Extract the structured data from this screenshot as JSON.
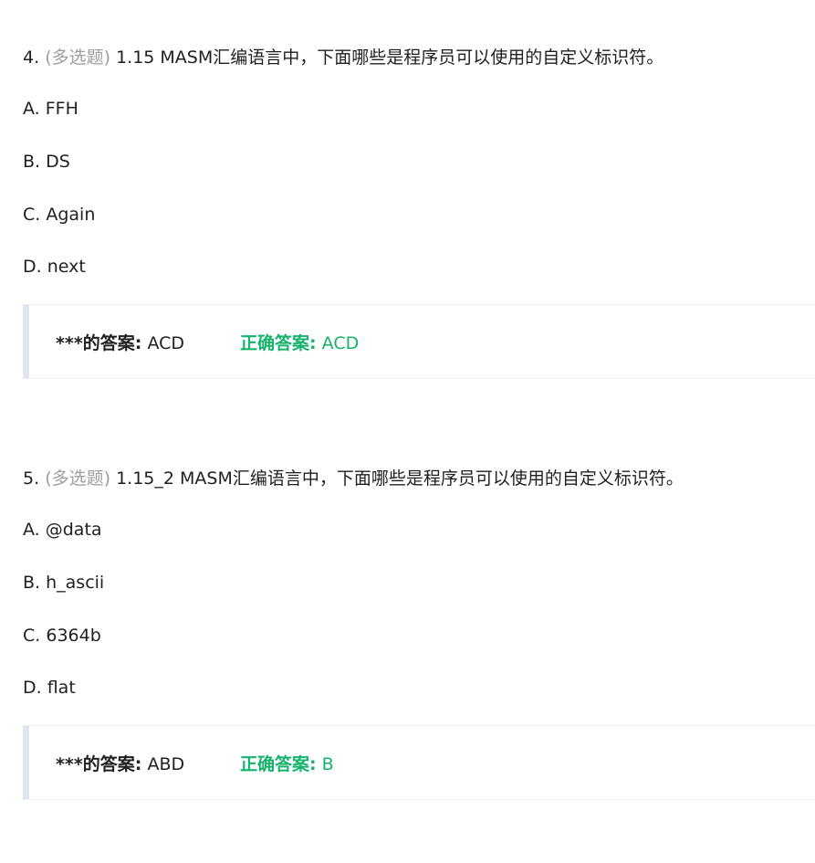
{
  "questions": [
    {
      "number": "4.",
      "type": "(多选题)",
      "text": "1.15 MASM汇编语言中，下面哪些是程序员可以使用的自定义标识符。",
      "options": [
        {
          "letter": "A.",
          "text": "FFH"
        },
        {
          "letter": "B.",
          "text": "DS"
        },
        {
          "letter": "C.",
          "text": "Again"
        },
        {
          "letter": "D.",
          "text": "next"
        }
      ],
      "my_answer_label": "***的答案:",
      "my_answer": "ACD",
      "correct_answer_label": "正确答案:",
      "correct_answer": "ACD"
    },
    {
      "number": "5.",
      "type": "(多选题)",
      "text": "1.15_2 MASM汇编语言中，下面哪些是程序员可以使用的自定义标识符。",
      "options": [
        {
          "letter": "A.",
          "text": "@data"
        },
        {
          "letter": "B.",
          "text": "h_ascii"
        },
        {
          "letter": "C.",
          "text": "6364b"
        },
        {
          "letter": "D.",
          "text": "flat"
        }
      ],
      "my_answer_label": "***的答案:",
      "my_answer": "ABD",
      "correct_answer_label": "正确答案:",
      "correct_answer": "B"
    }
  ],
  "colors": {
    "type_tag": "#9e9e9e",
    "correct": "#15b36b",
    "answer_bar": "#dfe6ee",
    "text": "#1f1f1f"
  }
}
